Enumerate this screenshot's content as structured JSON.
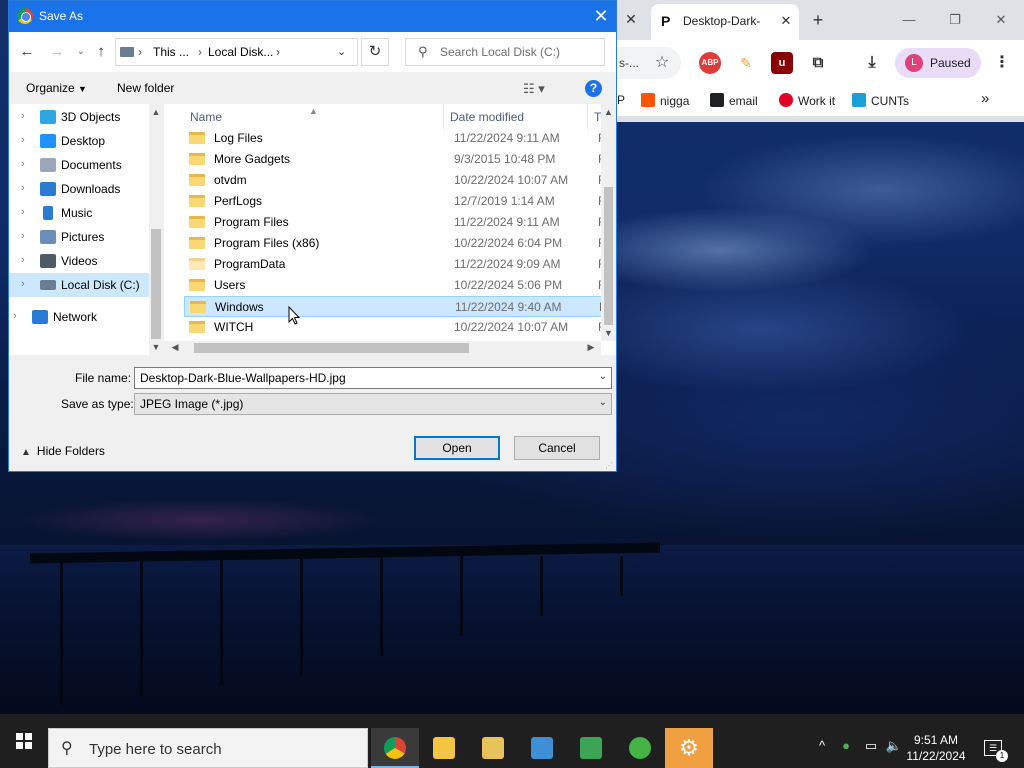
{
  "colors": {
    "accent": "#1a73e8",
    "selection": "#cce8ff",
    "folder": "#f8d775",
    "taskbar": "#1f1f1f"
  },
  "browser": {
    "tab_title": "Desktop-Dark-",
    "omnibox_fragment": "s-...",
    "profile_initial": "L",
    "profile_label": "Paused",
    "extensions": [
      "abp-icon",
      "puzzle-icon",
      "ublock-icon",
      "extensions-icon"
    ],
    "bookmarks": [
      {
        "label": "P",
        "icon": "bookmark-icon"
      },
      {
        "label": "nigga",
        "icon": "soundcloud-icon"
      },
      {
        "label": "email",
        "icon": "gmail-icon"
      },
      {
        "label": "Work it",
        "icon": "pinterest-icon"
      },
      {
        "label": "CUNTs",
        "icon": "docs-icon"
      }
    ],
    "more_bookmarks": "»"
  },
  "dialog": {
    "title": "Save As",
    "address": {
      "segments": [
        "This ...",
        "Local Disk..."
      ]
    },
    "search_placeholder": "Search Local Disk (C:)",
    "toolbar": {
      "organize": "Organize",
      "new_folder": "New folder"
    },
    "tree": [
      {
        "label": "3D Objects",
        "icon": "3d-objects-icon",
        "color": "#2ea6e0"
      },
      {
        "label": "Desktop",
        "icon": "desktop-icon",
        "color": "#1e90ff"
      },
      {
        "label": "Documents",
        "icon": "documents-icon",
        "color": "#9aa7b8"
      },
      {
        "label": "Downloads",
        "icon": "downloads-icon",
        "color": "#2a7bd4"
      },
      {
        "label": "Music",
        "icon": "music-icon",
        "color": "#2a7bd4"
      },
      {
        "label": "Pictures",
        "icon": "pictures-icon",
        "color": "#6b8fb8"
      },
      {
        "label": "Videos",
        "icon": "videos-icon",
        "color": "#505a66"
      },
      {
        "label": "Local Disk (C:)",
        "icon": "drive-icon",
        "color": "#6b7d93",
        "selected": true
      },
      {
        "label": "Network",
        "icon": "network-icon",
        "color": "#2a7bd4"
      }
    ],
    "columns": {
      "name": "Name",
      "date": "Date modified",
      "type": "Ty"
    },
    "files": [
      {
        "name": "Log Files",
        "date": "11/22/2024 9:11 AM",
        "type": "Fi"
      },
      {
        "name": "More Gadgets",
        "date": "9/3/2015 10:48 PM",
        "type": "Fi"
      },
      {
        "name": "otvdm",
        "date": "10/22/2024 10:07 AM",
        "type": "Fi"
      },
      {
        "name": "PerfLogs",
        "date": "12/7/2019 1:14 AM",
        "type": "Fi"
      },
      {
        "name": "Program Files",
        "date": "11/22/2024 9:11 AM",
        "type": "Fi"
      },
      {
        "name": "Program Files (x86)",
        "date": "10/22/2024 6:04 PM",
        "type": "Fi"
      },
      {
        "name": "ProgramData",
        "date": "11/22/2024 9:09 AM",
        "type": "Fi"
      },
      {
        "name": "Users",
        "date": "10/22/2024 5:06 PM",
        "type": "Fi"
      },
      {
        "name": "Windows",
        "date": "11/22/2024 9:40 AM",
        "type": "Fi",
        "selected": true
      },
      {
        "name": "WITCH",
        "date": "10/22/2024 10:07 AM",
        "type": "Fi"
      }
    ],
    "file_name_label": "File name:",
    "file_name": "Desktop-Dark-Blue-Wallpapers-HD.jpg",
    "save_type_label": "Save as type:",
    "save_type": "JPEG Image (*.jpg)",
    "hide_folders": "Hide Folders",
    "open_button": "Open",
    "cancel_button": "Cancel"
  },
  "taskbar": {
    "search_placeholder": "Type here to search",
    "apps": [
      {
        "icon": "chrome-icon",
        "color": "#db4437",
        "active": true
      },
      {
        "icon": "file-explorer-icon",
        "color": "#f4c542"
      },
      {
        "icon": "photo-viewer-icon",
        "color": "#e8c35a"
      },
      {
        "icon": "control-panel-icon",
        "color": "#3d8fd6"
      },
      {
        "icon": "task-manager-icon",
        "color": "#3aa655"
      },
      {
        "icon": "users-icon",
        "color": "#44b544"
      },
      {
        "icon": "settings-icon",
        "color": "#f0a040",
        "highlight": true
      }
    ],
    "time": "9:51 AM",
    "date": "11/22/2024",
    "notification_count": "1"
  }
}
